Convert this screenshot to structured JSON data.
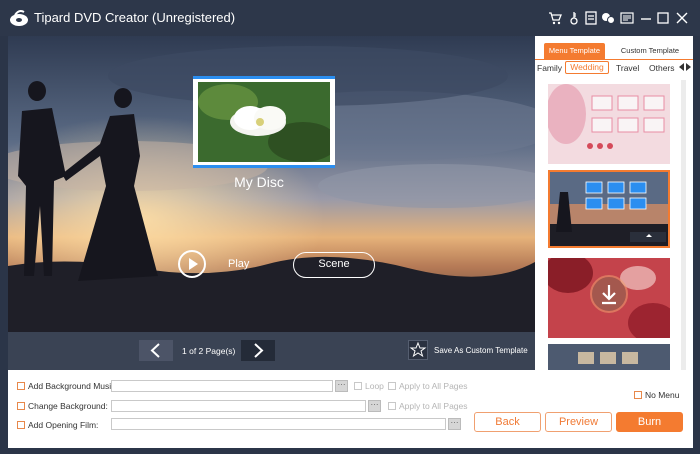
{
  "window": {
    "title": "Tipard DVD Creator (Unregistered)"
  },
  "toolbar": {
    "icons": [
      "cart-icon",
      "key-icon",
      "document-icon",
      "chat-icon",
      "menu-icon"
    ],
    "window_controls": [
      "minimize-icon",
      "maximize-icon",
      "close-icon"
    ]
  },
  "preview": {
    "disc_title": "My Disc",
    "play_label": "Play",
    "scene_label": "Scene"
  },
  "pagination": {
    "page_text": "1 of 2 Page(s)",
    "save_template_label": "Save As Custom Template"
  },
  "sidebar": {
    "tabs": [
      {
        "label": "Menu Template",
        "active": true
      },
      {
        "label": "Custom Template",
        "active": false
      }
    ],
    "categories": [
      {
        "label": "Family",
        "active": false
      },
      {
        "label": "Wedding",
        "active": true
      },
      {
        "label": "Travel",
        "active": false
      },
      {
        "label": "Others",
        "active": false
      }
    ]
  },
  "options": {
    "bg_music_label": "Add Background Music:",
    "loop_label": "Loop",
    "apply_all_1": "Apply to All Pages",
    "change_bg_label": "Change Background:",
    "apply_all_2": "Apply to All Pages",
    "opening_film_label": "Add Opening Film:",
    "no_menu_label": "No Menu",
    "dots": "···"
  },
  "actions": {
    "back": "Back",
    "preview": "Preview",
    "burn": "Burn"
  },
  "colors": {
    "accent": "#f47b30",
    "titlebar": "#2d374a",
    "frame_blue": "#2b8ef0"
  }
}
